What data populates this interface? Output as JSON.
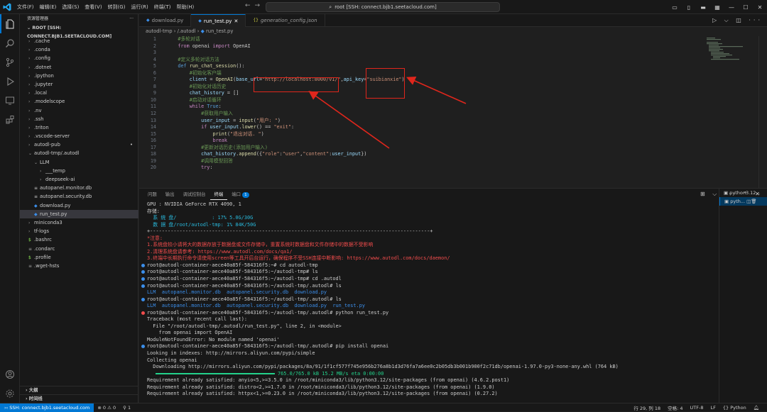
{
  "menu": [
    "文件(F)",
    "编辑(E)",
    "选择(S)",
    "查看(V)",
    "转到(G)",
    "运行(R)",
    "终端(T)",
    "帮助(H)"
  ],
  "search": {
    "text": "root [SSH: connect.bjb1.seetacloud.com]"
  },
  "sidebar": {
    "header": "资源管理器",
    "root": "ROOT [SSH: CONNECT.BJB1.SEETACLOUD.COM]",
    "items": [
      {
        "label": ".cache",
        "kind": "folder",
        "depth": 1
      },
      {
        "label": ".conda",
        "kind": "folder",
        "depth": 1
      },
      {
        "label": ".config",
        "kind": "folder",
        "depth": 1
      },
      {
        "label": ".dotnet",
        "kind": "folder",
        "depth": 1
      },
      {
        "label": ".ipython",
        "kind": "folder",
        "depth": 1
      },
      {
        "label": ".jupyter",
        "kind": "folder",
        "depth": 1
      },
      {
        "label": ".local",
        "kind": "folder",
        "depth": 1
      },
      {
        "label": ".modelscope",
        "kind": "folder",
        "depth": 1
      },
      {
        "label": ".nv",
        "kind": "folder",
        "depth": 1
      },
      {
        "label": ".ssh",
        "kind": "folder",
        "depth": 1
      },
      {
        "label": ".triton",
        "kind": "folder",
        "depth": 1
      },
      {
        "label": ".vscode-server",
        "kind": "folder",
        "depth": 1
      },
      {
        "label": "autodl-pub",
        "kind": "folder",
        "depth": 1,
        "dot": "•"
      },
      {
        "label": "autodl-tmp/.autodl",
        "kind": "open",
        "depth": 1
      },
      {
        "label": "LLM",
        "kind": "open",
        "depth": 2
      },
      {
        "label": "___temp",
        "kind": "folder",
        "depth": 3
      },
      {
        "label": "deepseek-ai",
        "kind": "folder",
        "depth": 3
      },
      {
        "label": "autopanel.monitor.db",
        "kind": "db",
        "depth": 2
      },
      {
        "label": "autopanel.security.db",
        "kind": "db",
        "depth": 2
      },
      {
        "label": "download.py",
        "kind": "py",
        "depth": 2
      },
      {
        "label": "run_test.py",
        "kind": "py",
        "depth": 2,
        "selected": true
      },
      {
        "label": "miniconda3",
        "kind": "folder",
        "depth": 1
      },
      {
        "label": "tf-logs",
        "kind": "folder",
        "depth": 1
      },
      {
        "label": ".bashrc",
        "kind": "sh",
        "depth": 1
      },
      {
        "label": ".condarc",
        "kind": "file",
        "depth": 1
      },
      {
        "label": ".profile",
        "kind": "sh",
        "depth": 1
      },
      {
        "label": ".wget-hsts",
        "kind": "file",
        "depth": 1
      }
    ],
    "outline": "大纲",
    "timeline": "时间线"
  },
  "tabs": [
    {
      "label": "download.py",
      "icon": "python-icon",
      "active": false
    },
    {
      "label": "run_test.py",
      "icon": "python-icon",
      "active": true
    },
    {
      "label": "generation_config.json",
      "icon": "json-icon",
      "active": false
    }
  ],
  "breadcrumb": [
    "autodl-tmp",
    "/.autodl",
    "run_test.py"
  ],
  "code": [
    [
      [
        "cm",
        "    #多轮对话"
      ]
    ],
    [
      [
        "kw",
        "    from"
      ],
      [
        "tx",
        " openai "
      ],
      [
        "kw",
        "import"
      ],
      [
        "tx",
        " OpenAI"
      ]
    ],
    [
      [
        "tx",
        ""
      ]
    ],
    [
      [
        "cm",
        "    #定义多轮对话方法"
      ]
    ],
    [
      [
        "kb",
        "    def"
      ],
      [
        "fn",
        " run_chat_session"
      ],
      [
        "tx",
        "():"
      ]
    ],
    [
      [
        "cm",
        "        #初始化客户端"
      ]
    ],
    [
      [
        "vr",
        "        client"
      ],
      [
        "tx",
        " = "
      ],
      [
        "fn",
        "OpenAI"
      ],
      [
        "tx",
        "("
      ],
      [
        "vr",
        "base_url"
      ],
      [
        "tx",
        "="
      ],
      [
        "st",
        "\"http://localhost:8000/v1/\""
      ],
      [
        "tx",
        ","
      ],
      [
        "vr",
        "api_key"
      ],
      [
        "tx",
        "="
      ],
      [
        "st",
        "\"suibianxie\""
      ],
      [
        "tx",
        ")"
      ]
    ],
    [
      [
        "cm",
        "        #初始化对话历史"
      ]
    ],
    [
      [
        "vr",
        "        chat_history"
      ],
      [
        "tx",
        " = []"
      ]
    ],
    [
      [
        "cm",
        "        #启动对话循环"
      ]
    ],
    [
      [
        "kw",
        "        while"
      ],
      [
        "kb",
        " True"
      ],
      [
        "tx",
        ":"
      ]
    ],
    [
      [
        "cm",
        "            #获取用户输入"
      ]
    ],
    [
      [
        "vr",
        "            user_input"
      ],
      [
        "tx",
        " = "
      ],
      [
        "fn",
        "input"
      ],
      [
        "tx",
        "("
      ],
      [
        "st",
        "\"用户: \""
      ],
      [
        "tx",
        ")"
      ]
    ],
    [
      [
        "kw",
        "            if"
      ],
      [
        "vr",
        " user_input"
      ],
      [
        "tx",
        "."
      ],
      [
        "fn",
        "lower"
      ],
      [
        "tx",
        "() == "
      ],
      [
        "st",
        "\"exit\""
      ],
      [
        "tx",
        ":"
      ]
    ],
    [
      [
        "fn",
        "                print"
      ],
      [
        "tx",
        "("
      ],
      [
        "st",
        "\"退出对话. \""
      ],
      [
        "tx",
        ")"
      ]
    ],
    [
      [
        "kw",
        "                break"
      ]
    ],
    [
      [
        "cm",
        "            #更新对话历史(添加用户输入)"
      ]
    ],
    [
      [
        "vr",
        "            chat_history"
      ],
      [
        "tx",
        "."
      ],
      [
        "fn",
        "append"
      ],
      [
        "tx",
        "({"
      ],
      [
        "st",
        "\"role\""
      ],
      [
        "tx",
        ":"
      ],
      [
        "st",
        "\"user\""
      ],
      [
        "tx",
        ","
      ],
      [
        "st",
        "\"content\""
      ],
      [
        "tx",
        ":"
      ],
      [
        "vr",
        "user_input"
      ],
      [
        "tx",
        "})"
      ]
    ],
    [
      [
        "cm",
        "            #调用模型回答"
      ]
    ],
    [
      [
        "kw",
        "            try"
      ],
      [
        "tx",
        ":"
      ]
    ]
  ],
  "panel_tabs": [
    {
      "label": "问题"
    },
    {
      "label": "输出"
    },
    {
      "label": "调试控制台"
    },
    {
      "label": "终端",
      "active": true
    },
    {
      "label": "端口",
      "badge": "1"
    }
  ],
  "terminal": [
    {
      "t": "GPU : NVIDIA GeForce RTX 4090, 1"
    },
    {
      "t": "存储:"
    },
    {
      "t": "  系 统 盘/            : 17% 5.0G/30G",
      "c": "tc"
    },
    {
      "t": "  数 据 盘/root/autodl-tmp: 1% 84K/50G",
      "c": "tc"
    },
    {
      "t": "+-----------------------------------------------------------------------------------------------+"
    },
    {
      "t": "*注意:",
      "c": "tr"
    },
    {
      "t": "1.系统盘较小请将大的数据存放于数据盘或文件存储中，重置系统时数据盘和文件存储中的数据不受影响",
      "c": "tr"
    },
    {
      "t": "2.清理系统盘请参考: https://www.autodl.com/docs/qa1/",
      "c": "tr"
    },
    {
      "t": "3.终端中长期执行命令请使用screen等工具开后台运行，确保程序不受SSH连接中断影响: https://www.autodl.com/docs/daemon/",
      "c": "tr"
    },
    {
      "t": "root@autodl-container-aece40a85f-584316f5:~# cd autodl-tmp",
      "b": "b"
    },
    {
      "t": "root@autodl-container-aece40a85f-584316f5:~/autodl-tmp# ls",
      "b": "b"
    },
    {
      "t": "root@autodl-container-aece40a85f-584316f5:~/autodl-tmp# cd .autodl",
      "b": "b"
    },
    {
      "t": "root@autodl-container-aece40a85f-584316f5:~/autodl-tmp/.autodl# ls",
      "b": "b"
    },
    {
      "t": "LLM  autopanel.monitor.db  autopanel.security.db  download.py",
      "c": "tdb"
    },
    {
      "t": "root@autodl-container-aece40a85f-584316f5:~/autodl-tmp/.autodl# ls",
      "b": "b"
    },
    {
      "t": "LLM  autopanel.monitor.db  autopanel.security.db  download.py  run_test.py",
      "c": "tdb"
    },
    {
      "t": "root@autodl-container-aece40a85f-584316f5:~/autodl-tmp/.autodl# python run_test.py",
      "b": "r"
    },
    {
      "t": "Traceback (most recent call last):"
    },
    {
      "t": "  File \"/root/autodl-tmp/.autodl/run_test.py\", line 2, in <module>"
    },
    {
      "t": "    from openai import OpenAI"
    },
    {
      "t": "ModuleNotFoundError: No module named 'openai'"
    },
    {
      "t": "root@autodl-container-aece40a85f-584316f5:~/autodl-tmp/.autodl# pip install openai",
      "b": "b"
    },
    {
      "t": "Looking in indexes: http://mirrors.aliyun.com/pypi/simple"
    },
    {
      "t": "Collecting openai"
    },
    {
      "t": "  Downloading http://mirrors.aliyun.com/pypi/packages/8a/91/1f1cf577f745e956b276a8b1d3d76fa7a6ee0c2b05db3b001b900f2c71db/openai-1.97.0-py3-none-any.whl (764 kB)"
    },
    {
      "t": "765.0/765.0 kB 15.2 MB/s eta 0:00:00",
      "progress": 1.0
    },
    {
      "t": "Requirement already satisfied: anyio<5,>=3.5.0 in /root/miniconda3/lib/python3.12/site-packages (from openai) (4.6.2.post1)"
    },
    {
      "t": "Requirement already satisfied: distro<2,>=1.7.0 in /root/miniconda3/lib/python3.12/site-packages (from openai) (1.9.0)"
    },
    {
      "t": "Requirement already satisfied: httpx<1,>=0.23.0 in /root/miniconda3/lib/python3.12/site-packages (from openai) (0.27.2)"
    }
  ],
  "terminal_list": [
    {
      "label": "python3.12...",
      "selected": false
    },
    {
      "label": "pyth...",
      "selected": true
    }
  ],
  "status": {
    "remote": "SSH: connect.bjb1.seetacloud.com",
    "errors": "⊗ 0 ⚠ 0",
    "ports": "1",
    "position": "行 29, 列 18",
    "spaces": "空格: 4",
    "encoding": "UTF-8",
    "eol": "LF",
    "language": "Python"
  },
  "colors": {
    "accent": "#0078d4",
    "annotation": "#e0261c"
  }
}
